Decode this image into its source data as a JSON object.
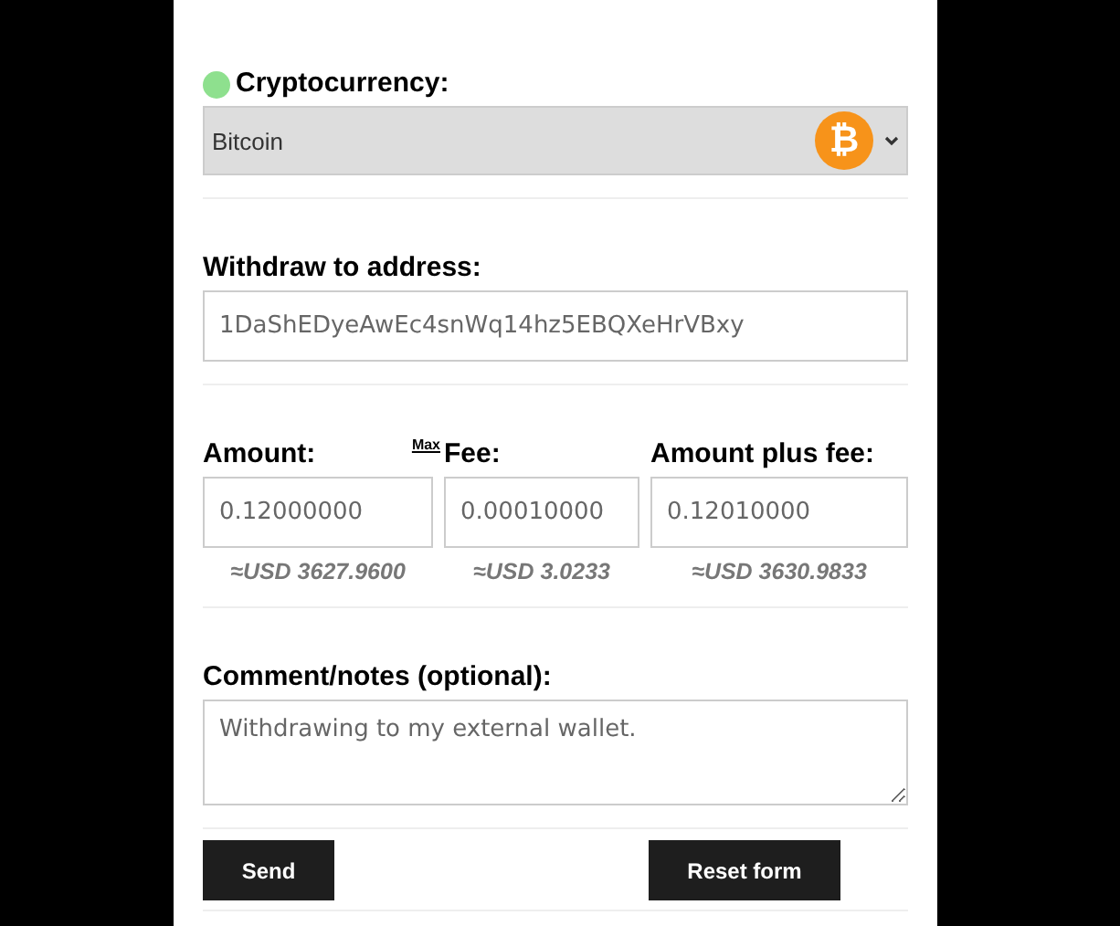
{
  "currency": {
    "label": "Cryptocurrency:",
    "color": "#8ee08e",
    "value": "Bitcoin",
    "coin_icon": "₿"
  },
  "address": {
    "label": "Withdraw to address:",
    "value": "1DaShEDyeAwEc4snWq14hz5EBQXeHrVBxy"
  },
  "amounts": [
    {
      "label": "Amount:",
      "link": "Max",
      "value": "0.12000000",
      "usd": "≈USD 3627.9600"
    },
    {
      "label": "Fee:",
      "value": "0.00010000",
      "usd": "≈USD 3.0233"
    },
    {
      "label": "Amount plus fee:",
      "value": "0.12010000",
      "usd": "≈USD 3630.9833"
    }
  ],
  "comment": {
    "label": "Comment/notes (optional):",
    "value": "Withdrawing to my external wallet."
  },
  "buttons": [
    "Send",
    "Reset form"
  ]
}
